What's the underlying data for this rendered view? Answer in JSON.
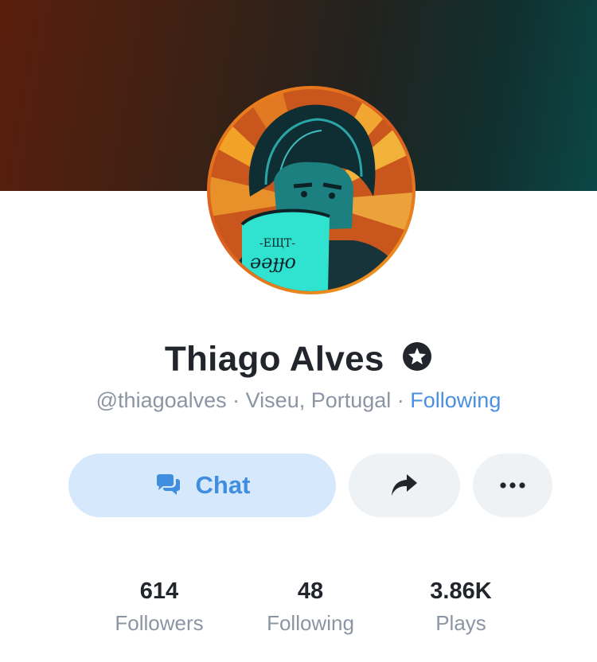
{
  "profile": {
    "name": "Thiago Alves",
    "handle": "@thiagoalves",
    "location": "Viseu, Portugal",
    "separator": " · ",
    "follow_status": "Following",
    "verified": true
  },
  "actions": {
    "chat_label": "Chat",
    "share_icon": "share-arrow-icon",
    "more_icon": "ellipsis-icon"
  },
  "stats": [
    {
      "value": "614",
      "label": "Followers"
    },
    {
      "value": "48",
      "label": "Following"
    },
    {
      "value": "3.86K",
      "label": "Plays"
    }
  ],
  "colors": {
    "accent": "#4a90e2",
    "chat_button_bg": "#d6e8fb",
    "secondary_button_bg": "#eff2f5",
    "text_primary": "#22252b",
    "text_secondary": "#8b95a3"
  }
}
